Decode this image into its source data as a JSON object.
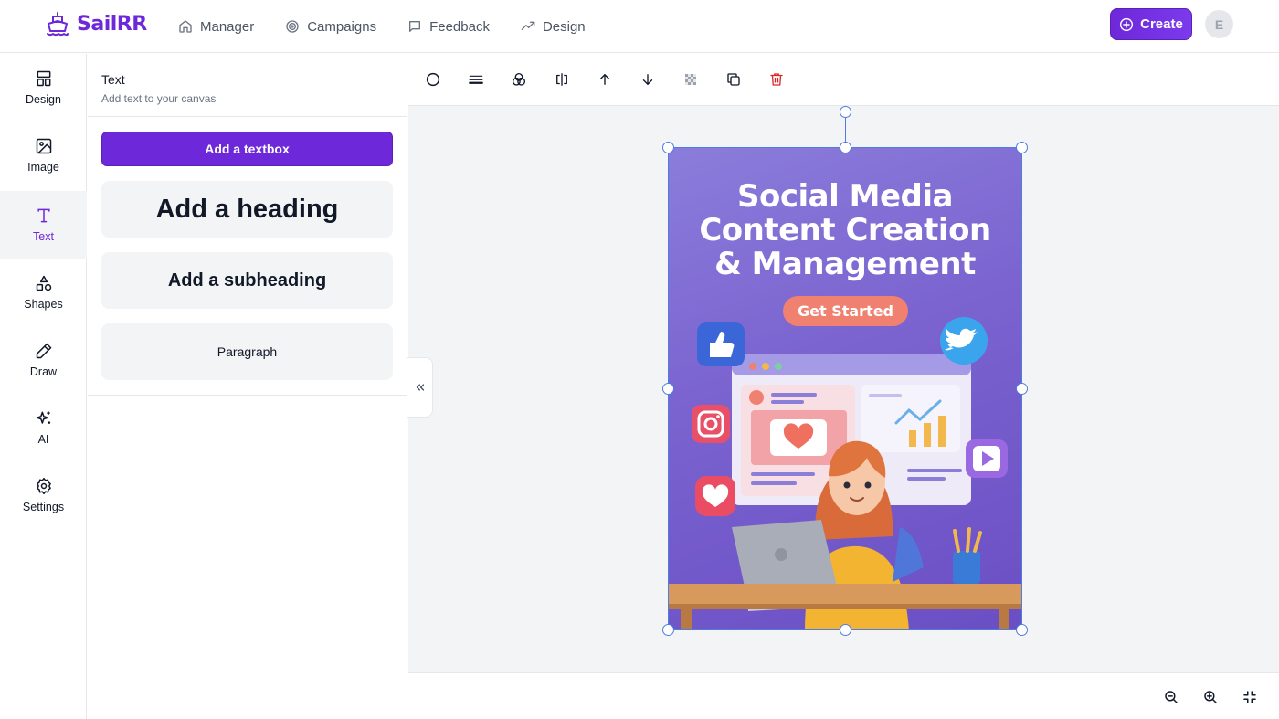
{
  "app": {
    "name": "SailRR"
  },
  "nav": [
    {
      "label": "Manager",
      "icon": "home-icon"
    },
    {
      "label": "Campaigns",
      "icon": "target-icon"
    },
    {
      "label": "Feedback",
      "icon": "message-icon"
    },
    {
      "label": "Design",
      "icon": "trending-icon"
    }
  ],
  "header": {
    "create_label": "Create",
    "avatar_initial": "E"
  },
  "rail": [
    {
      "label": "Design",
      "icon": "layout-icon",
      "active": false
    },
    {
      "label": "Image",
      "icon": "image-icon",
      "active": false
    },
    {
      "label": "Text",
      "icon": "type-icon",
      "active": true
    },
    {
      "label": "Shapes",
      "icon": "shapes-icon",
      "active": false
    },
    {
      "label": "Draw",
      "icon": "pencil-icon",
      "active": false
    },
    {
      "label": "AI",
      "icon": "sparkles-icon",
      "active": false
    },
    {
      "label": "Settings",
      "icon": "gear-icon",
      "active": false
    }
  ],
  "panel": {
    "title": "Text",
    "subtitle": "Add text to your canvas",
    "add_textbox": "Add a textbox",
    "add_heading": "Add a heading",
    "add_subheading": "Add a subheading",
    "add_paragraph": "Paragraph"
  },
  "poster": {
    "title_line1": "Social Media",
    "title_line2": "Content Creation",
    "title_line3": "& Management",
    "cta": "Get Started"
  },
  "colors": {
    "brand": "#6d28d9",
    "selection": "#4f7ce0",
    "delete": "#dc2626",
    "cta": "#f08070"
  }
}
